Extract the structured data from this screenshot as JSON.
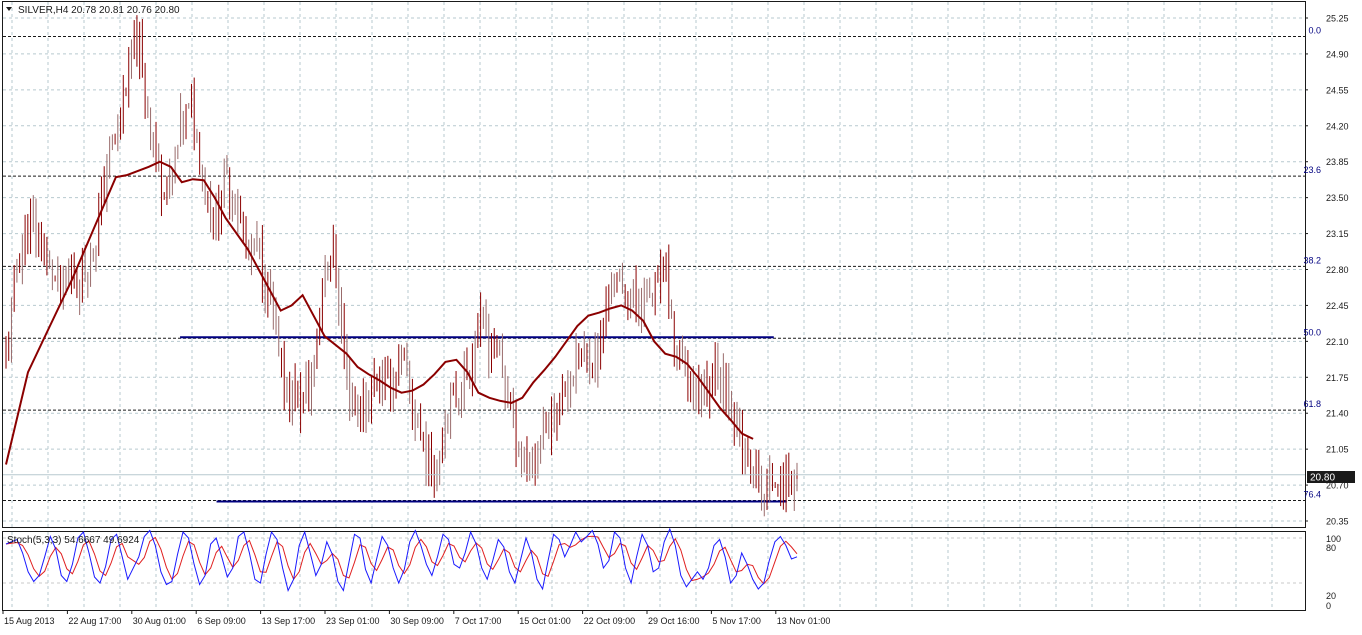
{
  "header": {
    "title": "SILVER,H4  20.78 20.81 20.76 20.80"
  },
  "colors": {
    "bars": "#996b6b",
    "bars_dark": "#8b0000",
    "ma": "#8b0000",
    "sr_line": "#000080",
    "fib_line": "#1a1a1a",
    "fib_label": "#000080",
    "grid": "#b7c9cf",
    "stoch_main": "#1a1aff",
    "stoch_signal": "#e02020",
    "price_tag_bg": "#1a1a1a",
    "price_tag_text": "#ffffff"
  },
  "price_axis": {
    "ticks": [
      "25.25",
      "24.90",
      "24.55",
      "24.20",
      "23.85",
      "23.50",
      "23.15",
      "22.80",
      "22.45",
      "22.10",
      "21.75",
      "21.40",
      "21.05",
      "20.70",
      "20.35"
    ],
    "current_price": "20.80"
  },
  "fibonacci": [
    {
      "label": "0.0",
      "price": 25.07
    },
    {
      "label": "23.6",
      "price": 23.71
    },
    {
      "label": "38.2",
      "price": 22.83
    },
    {
      "label": "50.0",
      "price": 22.13
    },
    {
      "label": "61.8",
      "price": 21.43
    },
    {
      "label": "76.4",
      "price": 20.55
    }
  ],
  "sr_lines": [
    {
      "price": 22.14,
      "from": 0.136,
      "to": 0.592
    },
    {
      "price": 20.54,
      "from": 0.164,
      "to": 0.602
    }
  ],
  "stochastic": {
    "label": "Stoch(5,3,3) 54.6667 49.6924",
    "ticks": [
      "100",
      "80",
      "20",
      "0"
    ],
    "main": 54.6667,
    "signal": 49.6924
  },
  "time_axis": {
    "labels": [
      "15 Aug 2013",
      "22 Aug 17:00",
      "30 Aug 01:00",
      "6 Sep 09:00",
      "13 Sep 17:00",
      "23 Sep 01:00",
      "30 Sep 09:00",
      "7 Oct 17:00",
      "15 Oct 01:00",
      "22 Oct 09:00",
      "29 Oct 16:00",
      "5 Nov 17:00",
      "13 Nov 01:00"
    ]
  },
  "chart_data": {
    "type": "line",
    "symbol": "SILVER",
    "timeframe": "H4",
    "ohlc_last": {
      "open": 20.78,
      "high": 20.81,
      "low": 20.76,
      "close": 20.8
    },
    "ylim": [
      20.3,
      25.3
    ],
    "x": [
      "15 Aug 2013",
      "22 Aug 17:00",
      "30 Aug 01:00",
      "6 Sep 09:00",
      "13 Sep 17:00",
      "23 Sep 01:00",
      "30 Sep 09:00",
      "7 Oct 17:00",
      "15 Oct 01:00",
      "22 Oct 09:00",
      "29 Oct 16:00",
      "5 Nov 17:00",
      "13 Nov 01:00"
    ],
    "price_path": [
      [
        0,
        21.9
      ],
      [
        2,
        22.8
      ],
      [
        4,
        23.3
      ],
      [
        6,
        23.1
      ],
      [
        8,
        22.8
      ],
      [
        10,
        22.6
      ],
      [
        12,
        22.8
      ],
      [
        14,
        22.7
      ],
      [
        16,
        23.0
      ],
      [
        18,
        23.7
      ],
      [
        20,
        24.1
      ],
      [
        22,
        24.7
      ],
      [
        24,
        25.0
      ],
      [
        26,
        24.3
      ],
      [
        28,
        23.7
      ],
      [
        30,
        23.6
      ],
      [
        32,
        24.2
      ],
      [
        34,
        24.4
      ],
      [
        36,
        23.6
      ],
      [
        38,
        23.3
      ],
      [
        40,
        23.7
      ],
      [
        42,
        23.5
      ],
      [
        44,
        22.9
      ],
      [
        46,
        23.0
      ],
      [
        48,
        22.5
      ],
      [
        50,
        21.8
      ],
      [
        52,
        21.6
      ],
      [
        54,
        21.5
      ],
      [
        56,
        21.8
      ],
      [
        58,
        22.9
      ],
      [
        60,
        22.9
      ],
      [
        62,
        21.7
      ],
      [
        64,
        21.4
      ],
      [
        66,
        21.6
      ],
      [
        68,
        21.8
      ],
      [
        70,
        21.7
      ],
      [
        72,
        21.9
      ],
      [
        74,
        21.5
      ],
      [
        76,
        21.1
      ],
      [
        78,
        20.8
      ],
      [
        80,
        21.4
      ],
      [
        82,
        21.6
      ],
      [
        84,
        21.8
      ],
      [
        86,
        22.3
      ],
      [
        88,
        22.1
      ],
      [
        90,
        21.9
      ],
      [
        92,
        21.4
      ],
      [
        94,
        21.0
      ],
      [
        96,
        20.9
      ],
      [
        98,
        21.3
      ],
      [
        100,
        21.4
      ],
      [
        102,
        21.7
      ],
      [
        104,
        21.9
      ],
      [
        106,
        21.95
      ],
      [
        108,
        22.0
      ],
      [
        110,
        22.7
      ],
      [
        112,
        22.6
      ],
      [
        114,
        22.5
      ],
      [
        116,
        22.5
      ],
      [
        118,
        22.6
      ],
      [
        120,
        22.8
      ],
      [
        122,
        21.9
      ],
      [
        124,
        21.8
      ],
      [
        126,
        21.6
      ],
      [
        128,
        21.75
      ],
      [
        130,
        21.8
      ],
      [
        132,
        21.6
      ],
      [
        134,
        21.0
      ],
      [
        136,
        20.8
      ],
      [
        138,
        20.6
      ],
      [
        140,
        20.8
      ],
      [
        142,
        20.75
      ],
      [
        144,
        20.8
      ]
    ],
    "ma_path": [
      [
        0,
        20.9
      ],
      [
        4,
        21.8
      ],
      [
        8,
        22.25
      ],
      [
        12,
        22.7
      ],
      [
        16,
        23.2
      ],
      [
        20,
        23.7
      ],
      [
        22,
        23.72
      ],
      [
        26,
        23.8
      ],
      [
        28,
        23.85
      ],
      [
        30,
        23.8
      ],
      [
        32,
        23.65
      ],
      [
        34,
        23.68
      ],
      [
        36,
        23.67
      ],
      [
        38,
        23.5
      ],
      [
        40,
        23.3
      ],
      [
        44,
        23.0
      ],
      [
        48,
        22.6
      ],
      [
        50,
        22.4
      ],
      [
        52,
        22.45
      ],
      [
        54,
        22.55
      ],
      [
        56,
        22.35
      ],
      [
        58,
        22.15
      ],
      [
        62,
        21.98
      ],
      [
        64,
        21.85
      ],
      [
        66,
        21.78
      ],
      [
        68,
        21.72
      ],
      [
        70,
        21.65
      ],
      [
        72,
        21.6
      ],
      [
        74,
        21.62
      ],
      [
        76,
        21.68
      ],
      [
        78,
        21.78
      ],
      [
        80,
        21.9
      ],
      [
        82,
        21.92
      ],
      [
        84,
        21.8
      ],
      [
        86,
        21.6
      ],
      [
        88,
        21.55
      ],
      [
        90,
        21.52
      ],
      [
        92,
        21.5
      ],
      [
        94,
        21.55
      ],
      [
        96,
        21.7
      ],
      [
        98,
        21.82
      ],
      [
        100,
        21.95
      ],
      [
        102,
        22.1
      ],
      [
        104,
        22.25
      ],
      [
        106,
        22.35
      ],
      [
        108,
        22.38
      ],
      [
        110,
        22.42
      ],
      [
        112,
        22.45
      ],
      [
        114,
        22.4
      ],
      [
        116,
        22.3
      ],
      [
        118,
        22.1
      ],
      [
        120,
        21.98
      ],
      [
        122,
        21.95
      ],
      [
        124,
        21.88
      ],
      [
        126,
        21.75
      ],
      [
        128,
        21.6
      ],
      [
        130,
        21.45
      ],
      [
        132,
        21.33
      ],
      [
        134,
        21.2
      ],
      [
        136,
        21.15
      ]
    ],
    "stoch_path": [
      [
        0,
        72
      ],
      [
        2,
        78
      ],
      [
        3,
        60
      ],
      [
        4,
        35
      ],
      [
        5,
        22
      ],
      [
        6,
        30
      ],
      [
        7,
        55
      ],
      [
        8,
        82
      ],
      [
        9,
        65
      ],
      [
        10,
        30
      ],
      [
        11,
        22
      ],
      [
        12,
        45
      ],
      [
        13,
        80
      ],
      [
        14,
        88
      ],
      [
        15,
        60
      ],
      [
        16,
        28
      ],
      [
        17,
        20
      ],
      [
        18,
        42
      ],
      [
        19,
        78
      ],
      [
        20,
        85
      ],
      [
        21,
        55
      ],
      [
        22,
        25
      ],
      [
        24,
        55
      ],
      [
        25,
        82
      ],
      [
        26,
        90
      ],
      [
        27,
        70
      ],
      [
        28,
        35
      ],
      [
        29,
        18
      ],
      [
        30,
        22
      ],
      [
        31,
        58
      ],
      [
        32,
        88
      ],
      [
        33,
        80
      ],
      [
        34,
        45
      ],
      [
        35,
        18
      ],
      [
        36,
        30
      ],
      [
        37,
        72
      ],
      [
        38,
        80
      ],
      [
        39,
        55
      ],
      [
        40,
        28
      ],
      [
        41,
        40
      ],
      [
        42,
        82
      ],
      [
        43,
        88
      ],
      [
        44,
        60
      ],
      [
        45,
        25
      ],
      [
        46,
        20
      ],
      [
        47,
        58
      ],
      [
        48,
        88
      ],
      [
        49,
        78
      ],
      [
        50,
        40
      ],
      [
        51,
        10
      ],
      [
        52,
        25
      ],
      [
        53,
        70
      ],
      [
        54,
        88
      ],
      [
        55,
        60
      ],
      [
        56,
        30
      ],
      [
        57,
        45
      ],
      [
        58,
        75
      ],
      [
        59,
        58
      ],
      [
        60,
        22
      ],
      [
        61,
        10
      ],
      [
        62,
        48
      ],
      [
        63,
        85
      ],
      [
        64,
        80
      ],
      [
        65,
        38
      ],
      [
        66,
        20
      ],
      [
        67,
        52
      ],
      [
        68,
        82
      ],
      [
        69,
        70
      ],
      [
        70,
        40
      ],
      [
        71,
        20
      ],
      [
        72,
        38
      ],
      [
        73,
        75
      ],
      [
        74,
        90
      ],
      [
        75,
        70
      ],
      [
        76,
        45
      ],
      [
        77,
        30
      ],
      [
        78,
        55
      ],
      [
        79,
        85
      ],
      [
        80,
        78
      ],
      [
        81,
        45
      ],
      [
        82,
        40
      ],
      [
        83,
        60
      ],
      [
        84,
        88
      ],
      [
        85,
        72
      ],
      [
        86,
        40
      ],
      [
        87,
        25
      ],
      [
        88,
        50
      ],
      [
        89,
        78
      ],
      [
        90,
        68
      ],
      [
        91,
        35
      ],
      [
        92,
        20
      ],
      [
        93,
        50
      ],
      [
        94,
        80
      ],
      [
        95,
        60
      ],
      [
        96,
        25
      ],
      [
        97,
        12
      ],
      [
        98,
        50
      ],
      [
        99,
        85
      ],
      [
        100,
        78
      ],
      [
        101,
        55
      ],
      [
        102,
        70
      ],
      [
        103,
        88
      ],
      [
        104,
        75
      ],
      [
        105,
        82
      ],
      [
        106,
        90
      ],
      [
        107,
        72
      ],
      [
        108,
        40
      ],
      [
        109,
        50
      ],
      [
        110,
        88
      ],
      [
        111,
        80
      ],
      [
        112,
        40
      ],
      [
        113,
        20
      ],
      [
        114,
        55
      ],
      [
        115,
        85
      ],
      [
        116,
        70
      ],
      [
        117,
        35
      ],
      [
        118,
        40
      ],
      [
        119,
        75
      ],
      [
        120,
        92
      ],
      [
        121,
        70
      ],
      [
        122,
        30
      ],
      [
        123,
        15
      ],
      [
        124,
        25
      ],
      [
        125,
        35
      ],
      [
        126,
        25
      ],
      [
        127,
        40
      ],
      [
        128,
        70
      ],
      [
        129,
        78
      ],
      [
        130,
        55
      ],
      [
        131,
        20
      ],
      [
        132,
        30
      ],
      [
        133,
        60
      ],
      [
        134,
        45
      ],
      [
        135,
        25
      ],
      [
        136,
        12
      ],
      [
        137,
        20
      ],
      [
        138,
        50
      ],
      [
        139,
        75
      ],
      [
        140,
        82
      ],
      [
        141,
        70
      ],
      [
        142,
        52
      ],
      [
        143,
        55
      ]
    ],
    "stoch_ylim": [
      0,
      100
    ]
  }
}
